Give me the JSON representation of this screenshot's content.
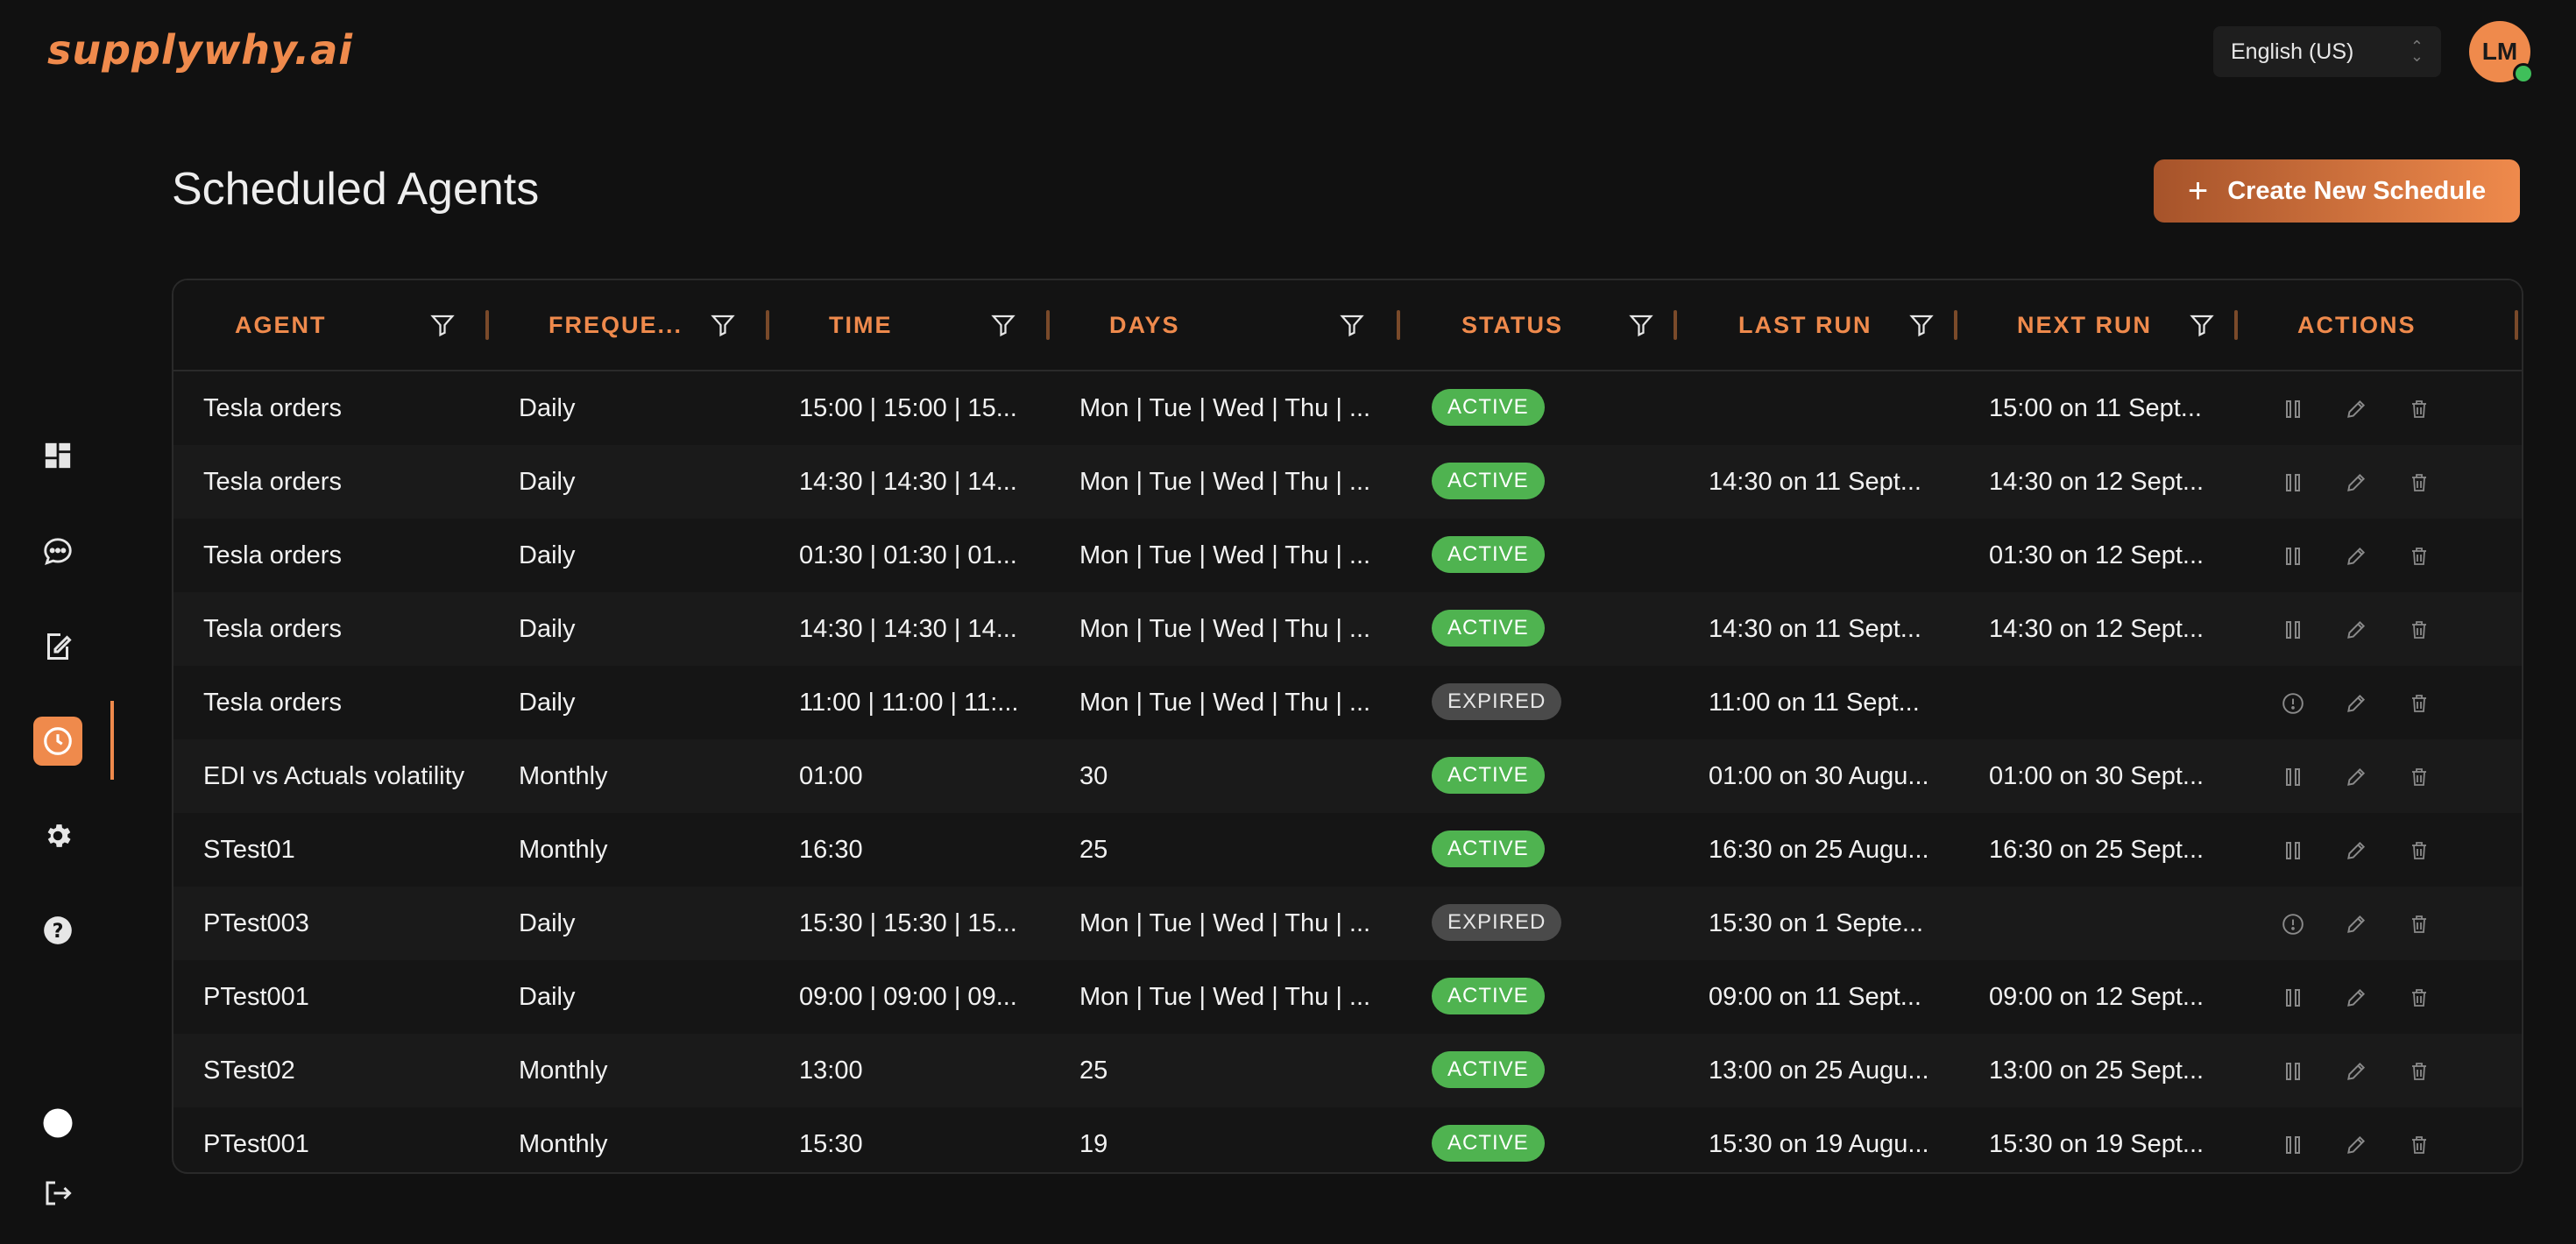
{
  "app": {
    "logo": "supplywhy.ai"
  },
  "header": {
    "language": "English (US)",
    "avatar_initials": "LM"
  },
  "page": {
    "title": "Scheduled Agents",
    "create_button": "Create New Schedule"
  },
  "sidebar": {
    "items": [
      {
        "name": "dashboard-icon"
      },
      {
        "name": "chat-icon"
      },
      {
        "name": "document-edit-icon"
      },
      {
        "name": "clock-icon",
        "active": true
      },
      {
        "name": "gear-icon"
      },
      {
        "name": "help-icon"
      }
    ],
    "bottom": [
      {
        "name": "theme-toggle-icon"
      },
      {
        "name": "logout-icon"
      }
    ]
  },
  "table": {
    "columns": [
      "AGENT",
      "FREQUE...",
      "TIME",
      "DAYS",
      "STATUS",
      "LAST RUN",
      "NEXT RUN",
      "ACTIONS"
    ],
    "rows": [
      {
        "agent": "Tesla orders",
        "frequency": "Daily",
        "time": "15:00 | 15:00 | 15...",
        "days": "Mon | Tue | Wed | Thu | ...",
        "status": "ACTIVE",
        "last_run": "",
        "next_run": "15:00 on 11 Sept..."
      },
      {
        "agent": "Tesla orders",
        "frequency": "Daily",
        "time": "14:30 | 14:30 | 14...",
        "days": "Mon | Tue | Wed | Thu | ...",
        "status": "ACTIVE",
        "last_run": "14:30 on 11 Sept...",
        "next_run": "14:30 on 12 Sept..."
      },
      {
        "agent": "Tesla orders",
        "frequency": "Daily",
        "time": "01:30 | 01:30 | 01...",
        "days": "Mon | Tue | Wed | Thu | ...",
        "status": "ACTIVE",
        "last_run": "",
        "next_run": "01:30 on 12 Sept..."
      },
      {
        "agent": "Tesla orders",
        "frequency": "Daily",
        "time": "14:30 | 14:30 | 14...",
        "days": "Mon | Tue | Wed | Thu | ...",
        "status": "ACTIVE",
        "last_run": "14:30 on 11 Sept...",
        "next_run": "14:30 on 12 Sept..."
      },
      {
        "agent": "Tesla orders",
        "frequency": "Daily",
        "time": "11:00 | 11:00 | 11:...",
        "days": "Mon | Tue | Wed | Thu | ...",
        "status": "EXPIRED",
        "last_run": "11:00 on 11 Sept...",
        "next_run": ""
      },
      {
        "agent": "EDI vs Actuals volatility",
        "frequency": "Monthly",
        "time": "01:00",
        "days": "30",
        "status": "ACTIVE",
        "last_run": "01:00 on 30 Augu...",
        "next_run": "01:00 on 30 Sept..."
      },
      {
        "agent": "STest01",
        "frequency": "Monthly",
        "time": "16:30",
        "days": "25",
        "status": "ACTIVE",
        "last_run": "16:30 on 25 Augu...",
        "next_run": "16:30 on 25 Sept..."
      },
      {
        "agent": "PTest003",
        "frequency": "Daily",
        "time": "15:30 | 15:30 | 15...",
        "days": "Mon | Tue | Wed | Thu | ...",
        "status": "EXPIRED",
        "last_run": "15:30 on 1 Septe...",
        "next_run": ""
      },
      {
        "agent": "PTest001",
        "frequency": "Daily",
        "time": "09:00 | 09:00 | 09...",
        "days": "Mon | Tue | Wed | Thu | ...",
        "status": "ACTIVE",
        "last_run": "09:00 on 11 Sept...",
        "next_run": "09:00 on 12 Sept..."
      },
      {
        "agent": "STest02",
        "frequency": "Monthly",
        "time": "13:00",
        "days": "25",
        "status": "ACTIVE",
        "last_run": "13:00 on 25 Augu...",
        "next_run": "13:00 on 25 Sept..."
      },
      {
        "agent": "PTest001",
        "frequency": "Monthly",
        "time": "15:30",
        "days": "19",
        "status": "ACTIVE",
        "last_run": "15:30 on 19 Augu...",
        "next_run": "15:30 on 19 Sept..."
      }
    ]
  },
  "colors": {
    "accent": "#ef8a4c",
    "active": "#4fb350",
    "expired": "#4a4a4a",
    "background": "#111111"
  }
}
